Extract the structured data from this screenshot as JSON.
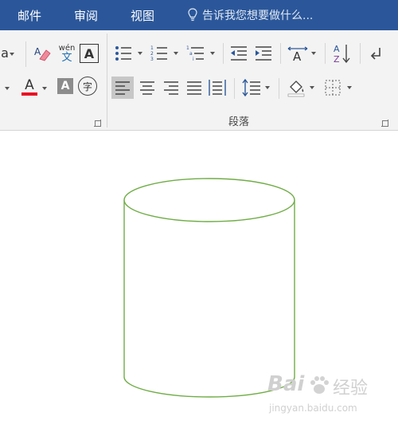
{
  "tabs": [
    {
      "label": "邮件"
    },
    {
      "label": "审阅"
    },
    {
      "label": "视图"
    }
  ],
  "tell_me": {
    "text": "告诉我您想要做什么..."
  },
  "font_group": {
    "partial_label": "a",
    "phonetic_top": "wén",
    "phonetic_bottom": "文",
    "border_char": "A",
    "font_color_char": "A",
    "shading_char": "A",
    "enclose_char": "字",
    "font_color": "#e81123"
  },
  "paragraph_group": {
    "label": "段落"
  },
  "watermark": {
    "brand": "Bai",
    "brand_cn": "经验",
    "url": "jingyan.baidu.com"
  },
  "colors": {
    "tab_bar": "#2b579a",
    "shape_stroke": "#70ad47",
    "ribbon_bg": "#f3f3f3"
  }
}
